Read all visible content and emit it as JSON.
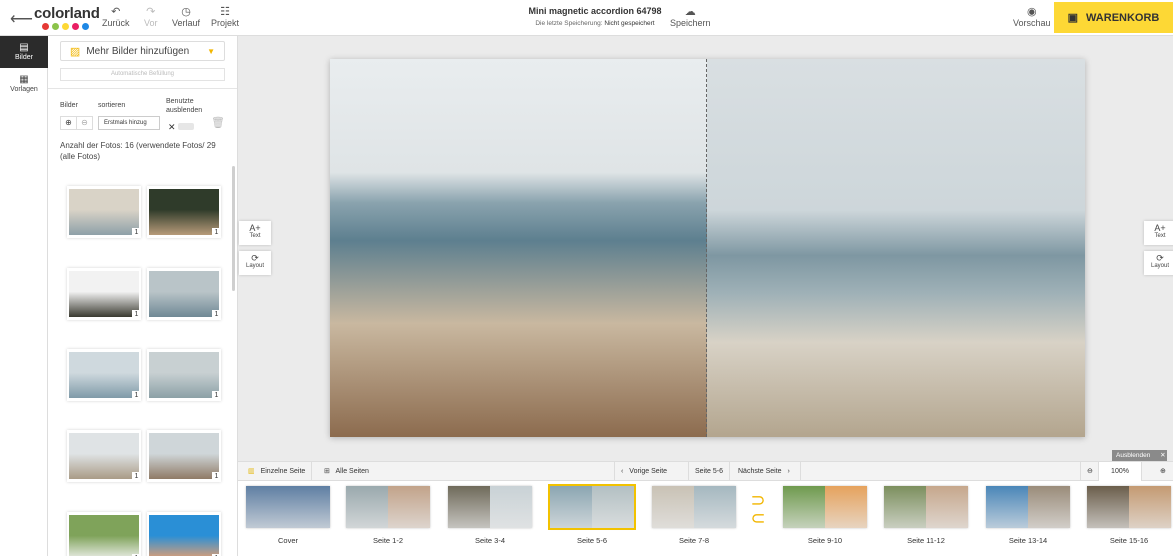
{
  "app": {
    "logo_text": "colorland",
    "logo_dots": [
      "#e53935",
      "#8bc34a",
      "#fdd835",
      "#e91e63",
      "#1e88e5"
    ]
  },
  "toolbar": {
    "undo_label": "Zurück",
    "redo_label": "Vor",
    "history_label": "Verlauf",
    "project_label": "Projekt",
    "save_label": "Speichern",
    "preview_label": "Vorschau",
    "cart_label": "WARENKORB"
  },
  "document": {
    "title": "Mini magnetic accordion 64798",
    "last_saved_label": "Die letzte Speicherung:",
    "last_saved_value": "Nicht gespeichert"
  },
  "rail": {
    "images_label": "Bilder",
    "templates_label": "Vorlagen"
  },
  "panel": {
    "add_images_label": "Mehr Bilder hinzufügen",
    "auto_fill_label": "Automatische Befüllung",
    "images_zoom_label": "Bilder",
    "sort_label": "sortieren",
    "sort_value": "Erstmals hinzug",
    "hide_used_label": "Benutzte ausblenden",
    "photo_count_text": "Anzahl der Fotos: 16 (verwendete Fotos/ 29 (alle Fotos)",
    "thumbnails": [
      {
        "count": "1",
        "colors": [
          "#d9d3c7",
          "#8ea0a8"
        ]
      },
      {
        "count": "1",
        "colors": [
          "#2f3b2a",
          "#b79b7a"
        ]
      },
      {
        "count": "1",
        "colors": [
          "#f2f2f2",
          "#3a3a30"
        ]
      },
      {
        "count": "1",
        "colors": [
          "#b9c4c8",
          "#6f8894"
        ]
      },
      {
        "count": "1",
        "colors": [
          "#cfd9de",
          "#7f9aa8"
        ]
      },
      {
        "count": "1",
        "colors": [
          "#c8d0d2",
          "#8ba0a6"
        ]
      },
      {
        "count": "1",
        "colors": [
          "#dfe3e5",
          "#a99b86"
        ]
      },
      {
        "count": "1",
        "colors": [
          "#cfd6d9",
          "#8f7a66"
        ]
      },
      {
        "count": "1",
        "colors": [
          "#7fa35a",
          "#f4f4f4"
        ]
      },
      {
        "count": "1",
        "colors": [
          "#2a8fd6",
          "#f0a06a"
        ]
      }
    ]
  },
  "side_tools": {
    "text_label": "Text",
    "layout_label": "Layout"
  },
  "bottom": {
    "single_page_label": "Einzelne Seite",
    "all_pages_label": "Alle Seiten",
    "prev_page_label": "Vorige Seite",
    "current_page_label": "Seite 5-6",
    "next_page_label": "Nächste Seite",
    "zoom_value": "100%",
    "hide_label": "Ausblenden"
  },
  "pages": [
    {
      "label": "Cover",
      "colors": [
        "#5f7fa3",
        "#5f7fa3"
      ]
    },
    {
      "label": "Seite 1-2",
      "colors": [
        "#9aa9ad",
        "#c2a38a"
      ]
    },
    {
      "label": "Seite 3-4",
      "colors": [
        "#6f6a5a",
        "#c9d2d6"
      ]
    },
    {
      "label": "Seite 5-6",
      "colors": [
        "#8ba6b2",
        "#b3c0c3"
      ]
    },
    {
      "label": "Seite 7-8",
      "colors": [
        "#c9c2b5",
        "#a5b8c0"
      ]
    },
    {
      "label": "Seite 9-10",
      "colors": [
        "#6f9a4e",
        "#e6a25d"
      ]
    },
    {
      "label": "Seite 11-12",
      "colors": [
        "#7c8f5e",
        "#c6a78c"
      ]
    },
    {
      "label": "Seite 13-14",
      "colors": [
        "#4a86b8",
        "#9a8c7a"
      ]
    },
    {
      "label": "Seite 15-16",
      "colors": [
        "#6b5e4b",
        "#c49a72"
      ]
    }
  ]
}
